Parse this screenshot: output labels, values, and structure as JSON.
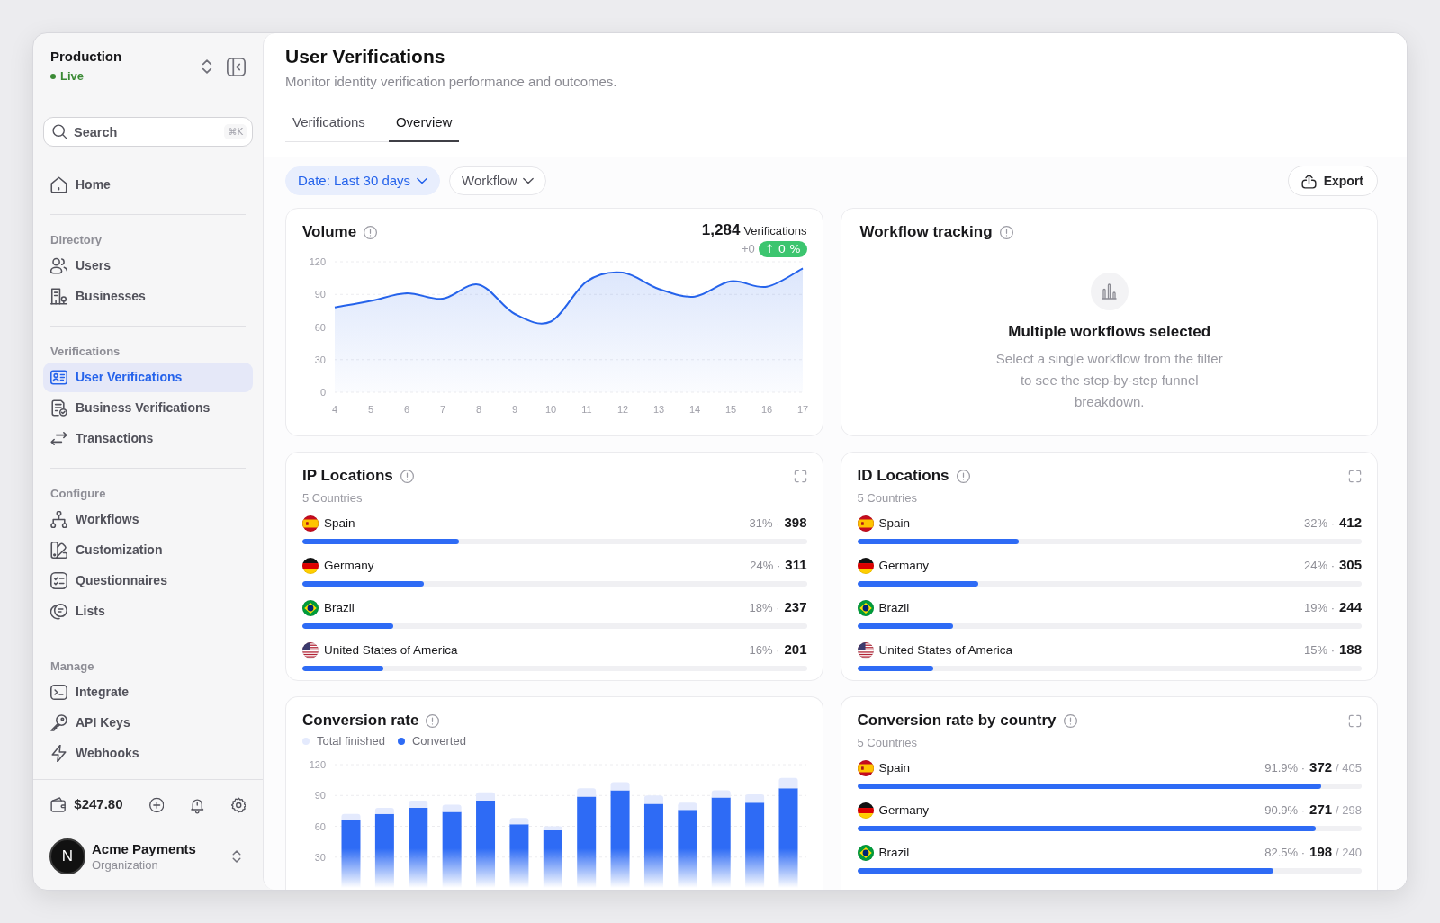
{
  "sidebar": {
    "workspace": {
      "name": "Production",
      "status": "Live"
    },
    "search": {
      "placeholder": "Search",
      "shortcut": "⌘K"
    },
    "sections": [
      {
        "items": [
          {
            "label": "Home",
            "selected": false
          }
        ]
      },
      {
        "title": "Directory",
        "items": [
          {
            "label": "Users",
            "selected": false
          },
          {
            "label": "Businesses",
            "selected": false
          }
        ]
      },
      {
        "title": "Verifications",
        "items": [
          {
            "label": "User Verifications",
            "selected": true
          },
          {
            "label": "Business Verifications",
            "selected": false
          },
          {
            "label": "Transactions",
            "selected": false
          }
        ]
      },
      {
        "title": "Configure",
        "items": [
          {
            "label": "Workflows",
            "selected": false
          },
          {
            "label": "Customization",
            "selected": false
          },
          {
            "label": "Questionnaires",
            "selected": false
          },
          {
            "label": "Lists",
            "selected": false
          }
        ]
      },
      {
        "title": "Manage",
        "items": [
          {
            "label": "Integrate",
            "selected": false
          },
          {
            "label": "API Keys",
            "selected": false
          },
          {
            "label": "Webhooks",
            "selected": false
          }
        ]
      }
    ],
    "balance": "$247.80",
    "organization": {
      "initial": "N",
      "name": "Acme Payments",
      "role": "Organization"
    }
  },
  "header": {
    "title": "User Verifications",
    "subtitle": "Monitor identity verification performance and outcomes.",
    "tabs": [
      {
        "label": "Verifications",
        "selected": false
      },
      {
        "label": "Overview",
        "selected": true
      }
    ]
  },
  "toolbar": {
    "filters": [
      {
        "label": "Date: Last 30 days",
        "applied": true
      },
      {
        "label": "Workflow",
        "applied": false
      }
    ],
    "export_button": "Export"
  },
  "volume": {
    "title": "Volume",
    "total": "1,284",
    "total_label": "Verifications",
    "change": "+0",
    "change_badge": "↑ 0 %",
    "chart_data": [
      {
        "type": "area",
        "categories": [
          "4",
          "5",
          "6",
          "7",
          "8",
          "9",
          "10",
          "11",
          "12",
          "13",
          "14",
          "15",
          "16",
          "17"
        ],
        "values": [
          78,
          84,
          91,
          86,
          99,
          72,
          65,
          102,
          110,
          95,
          88,
          102,
          97,
          114
        ],
        "color": "#2563eb",
        "yticks": [
          0,
          30,
          60,
          90,
          120
        ],
        "ylim": [
          0,
          120
        ],
        "grid": true
      }
    ]
  },
  "workflow_tracking": {
    "title": "Workflow tracking",
    "empty_title": "Multiple workflows selected",
    "empty_text": "Select a single workflow from the filter to see the step-by-step funnel breakdown."
  },
  "ip_locations": {
    "title": "IP Locations",
    "subtitle": "5 Countries",
    "rows": [
      {
        "country": "Spain",
        "percent": "31% ·",
        "count": "398",
        "level": 0.31
      },
      {
        "country": "Germany",
        "percent": "24% ·",
        "count": "311",
        "level": 0.24
      },
      {
        "country": "Brazil",
        "percent": "18% ·",
        "count": "237",
        "level": 0.18
      },
      {
        "country": "United States of America",
        "percent": "16% ·",
        "count": "201",
        "level": 0.16
      }
    ]
  },
  "id_locations": {
    "title": "ID Locations",
    "subtitle": "5 Countries",
    "rows": [
      {
        "country": "Spain",
        "percent": "32% ·",
        "count": "412",
        "level": 0.32
      },
      {
        "country": "Germany",
        "percent": "24% ·",
        "count": "305",
        "level": 0.24
      },
      {
        "country": "Brazil",
        "percent": "19% ·",
        "count": "244",
        "level": 0.19
      },
      {
        "country": "United States of America",
        "percent": "15% ·",
        "count": "188",
        "level": 0.15
      }
    ]
  },
  "conversion_rate": {
    "title": "Conversion rate",
    "chart_data": [
      {
        "type": "bar",
        "stacked": true,
        "series": [
          {
            "name": "Converted",
            "color": "#2e6bf5",
            "values": [
              66,
              72,
              78,
              74,
              85,
              62,
              56,
              89,
              95,
              82,
              76,
              88,
              83,
              97
            ]
          },
          {
            "name": "Total finished",
            "color": "#e4eafd",
            "values": [
              6,
              6,
              7,
              7,
              8,
              6,
              4,
              8,
              8,
              8,
              7,
              7,
              8,
              10
            ]
          }
        ],
        "yticks": [
          30,
          60,
          90,
          120
        ],
        "ylim": [
          0,
          120
        ],
        "grid": true
      }
    ]
  },
  "conversion_by_country": {
    "title": "Conversion rate by country",
    "subtitle": "5 Countries",
    "rows": [
      {
        "country": "Spain",
        "percent": "91.9% ·",
        "count": "372",
        "total": "/ 405",
        "level": 0.919
      },
      {
        "country": "Germany",
        "percent": "90.9% ·",
        "count": "271",
        "total": "/ 298",
        "level": 0.909
      },
      {
        "country": "Brazil",
        "percent": "82.5% ·",
        "count": "198",
        "total": "/ 240",
        "level": 0.825
      }
    ]
  }
}
